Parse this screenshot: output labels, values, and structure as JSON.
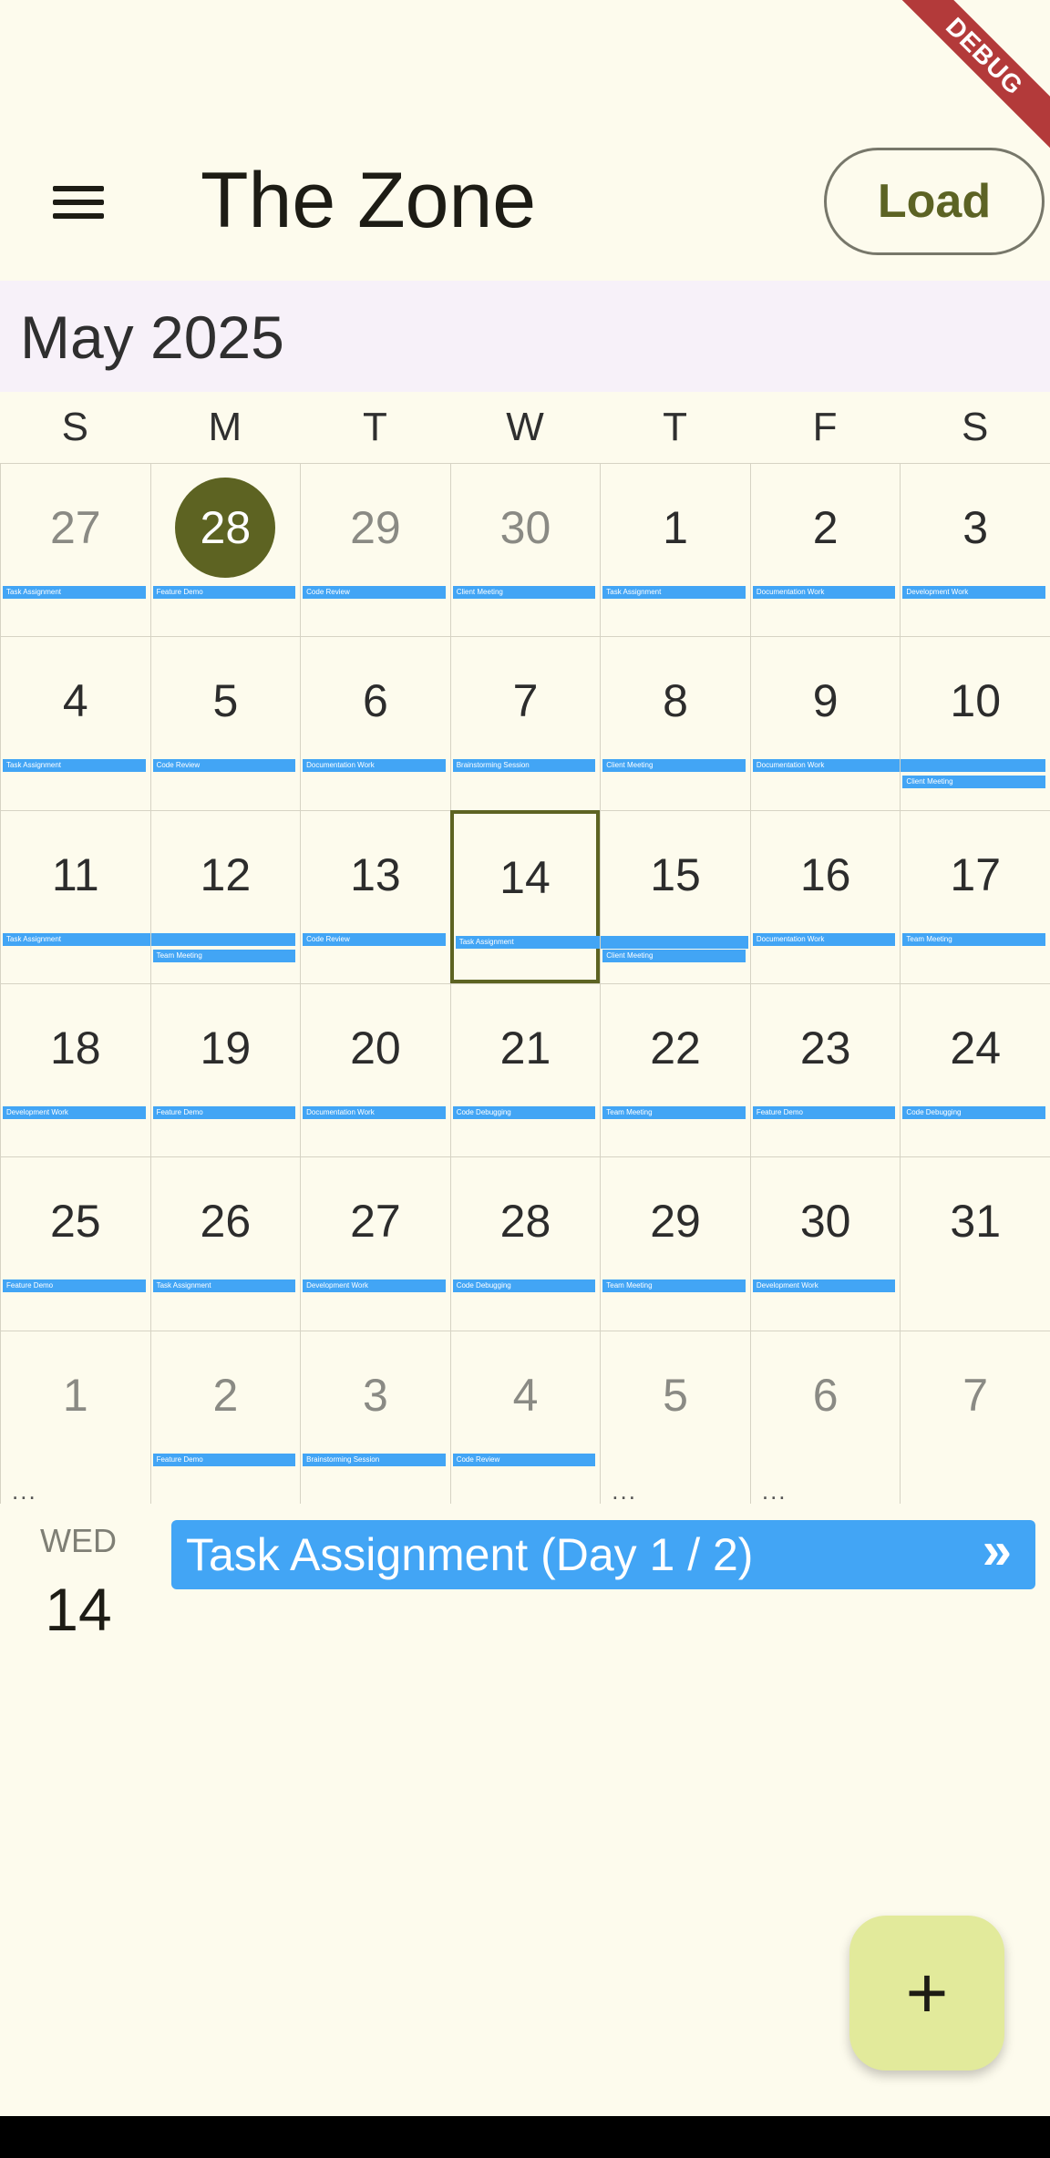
{
  "debug_label": "DEBUG",
  "appbar": {
    "title": "The Zone",
    "load_label": "Load",
    "menu_icon": "menu-icon"
  },
  "calendar": {
    "month_label": "May 2025",
    "weekdays": [
      "S",
      "M",
      "T",
      "W",
      "T",
      "F",
      "S"
    ],
    "weeks": [
      [
        {
          "num": "27",
          "other": true,
          "events": [
            {
              "label": "Task Assignment",
              "span": 1
            }
          ]
        },
        {
          "num": "28",
          "other": true,
          "today": true,
          "events": [
            {
              "label": "Feature Demo",
              "span": 1
            }
          ]
        },
        {
          "num": "29",
          "other": true,
          "events": [
            {
              "label": "Code Review",
              "span": 1
            }
          ]
        },
        {
          "num": "30",
          "other": true,
          "events": [
            {
              "label": "Client Meeting",
              "span": 1
            }
          ]
        },
        {
          "num": "1",
          "events": [
            {
              "label": "Task Assignment",
              "span": 1
            }
          ]
        },
        {
          "num": "2",
          "events": [
            {
              "label": "Documentation Work",
              "span": 1
            }
          ]
        },
        {
          "num": "3",
          "events": [
            {
              "label": "Development Work",
              "span": 1
            }
          ]
        }
      ],
      [
        {
          "num": "4",
          "events": [
            {
              "label": "Task Assignment",
              "span": 1
            }
          ]
        },
        {
          "num": "5",
          "events": [
            {
              "label": "Code Review",
              "span": 1
            }
          ]
        },
        {
          "num": "6",
          "events": [
            {
              "label": "Documentation Work",
              "span": 1
            }
          ]
        },
        {
          "num": "7",
          "events": [
            {
              "label": "Brainstorming Session",
              "span": 1
            }
          ]
        },
        {
          "num": "8",
          "events": [
            {
              "label": "Client Meeting",
              "span": 1
            }
          ]
        },
        {
          "num": "9",
          "events": [
            {
              "label": "Documentation Work",
              "span": 2
            }
          ]
        },
        {
          "num": "10",
          "events": [
            {
              "label": "Client Meeting",
              "span": 1,
              "row": 2
            }
          ]
        }
      ],
      [
        {
          "num": "11",
          "events": [
            {
              "label": "Task Assignment",
              "span": 2
            }
          ]
        },
        {
          "num": "12",
          "events": [
            {
              "label": "Team Meeting",
              "span": 1,
              "row": 2
            }
          ]
        },
        {
          "num": "13",
          "events": [
            {
              "label": "Code Review",
              "span": 1
            }
          ]
        },
        {
          "num": "14",
          "selected": true,
          "events": [
            {
              "label": "Task Assignment",
              "span": 2
            }
          ]
        },
        {
          "num": "15",
          "events": [
            {
              "label": "Client Meeting",
              "span": 1,
              "row": 2
            }
          ]
        },
        {
          "num": "16",
          "events": [
            {
              "label": "Documentation Work",
              "span": 1
            }
          ]
        },
        {
          "num": "17",
          "events": [
            {
              "label": "Team Meeting",
              "span": 1
            }
          ]
        }
      ],
      [
        {
          "num": "18",
          "events": [
            {
              "label": "Development Work",
              "span": 1
            }
          ]
        },
        {
          "num": "19",
          "events": [
            {
              "label": "Feature Demo",
              "span": 1
            }
          ]
        },
        {
          "num": "20",
          "events": [
            {
              "label": "Documentation Work",
              "span": 1
            }
          ]
        },
        {
          "num": "21",
          "events": [
            {
              "label": "Code Debugging",
              "span": 1
            }
          ]
        },
        {
          "num": "22",
          "events": [
            {
              "label": "Team Meeting",
              "span": 1
            }
          ]
        },
        {
          "num": "23",
          "events": [
            {
              "label": "Feature Demo",
              "span": 1
            }
          ]
        },
        {
          "num": "24",
          "events": [
            {
              "label": "Code Debugging",
              "span": 1
            }
          ]
        }
      ],
      [
        {
          "num": "25",
          "events": [
            {
              "label": "Feature Demo",
              "span": 1
            }
          ]
        },
        {
          "num": "26",
          "events": [
            {
              "label": "Task Assignment",
              "span": 1
            }
          ]
        },
        {
          "num": "27",
          "events": [
            {
              "label": "Development Work",
              "span": 1
            }
          ]
        },
        {
          "num": "28",
          "events": [
            {
              "label": "Code Debugging",
              "span": 1
            }
          ]
        },
        {
          "num": "29",
          "events": [
            {
              "label": "Team Meeting",
              "span": 1
            }
          ]
        },
        {
          "num": "30",
          "events": [
            {
              "label": "Development Work",
              "span": 1
            }
          ]
        },
        {
          "num": "31",
          "events": []
        }
      ],
      [
        {
          "num": "1",
          "other": true,
          "more": "..."
        },
        {
          "num": "2",
          "other": true,
          "events": [
            {
              "label": "Feature Demo",
              "span": 1
            }
          ]
        },
        {
          "num": "3",
          "other": true,
          "events": [
            {
              "label": "Brainstorming Session",
              "span": 1
            }
          ]
        },
        {
          "num": "4",
          "other": true,
          "events": [
            {
              "label": "Code Review",
              "span": 1
            }
          ]
        },
        {
          "num": "5",
          "other": true,
          "more": "..."
        },
        {
          "num": "6",
          "other": true,
          "more": "..."
        },
        {
          "num": "7",
          "other": true,
          "events": []
        }
      ]
    ]
  },
  "selected_day": {
    "weekday": "WED",
    "day": "14",
    "event_label": "Task Assignment (Day 1 / 2)",
    "event_icon": "double-chevron-right-icon"
  },
  "fab": {
    "icon": "plus-icon",
    "label": "+"
  },
  "colors": {
    "accent": "#5d6322",
    "event": "#42a5f5",
    "background": "#fdfbed",
    "fab": "#e2ea9b"
  }
}
